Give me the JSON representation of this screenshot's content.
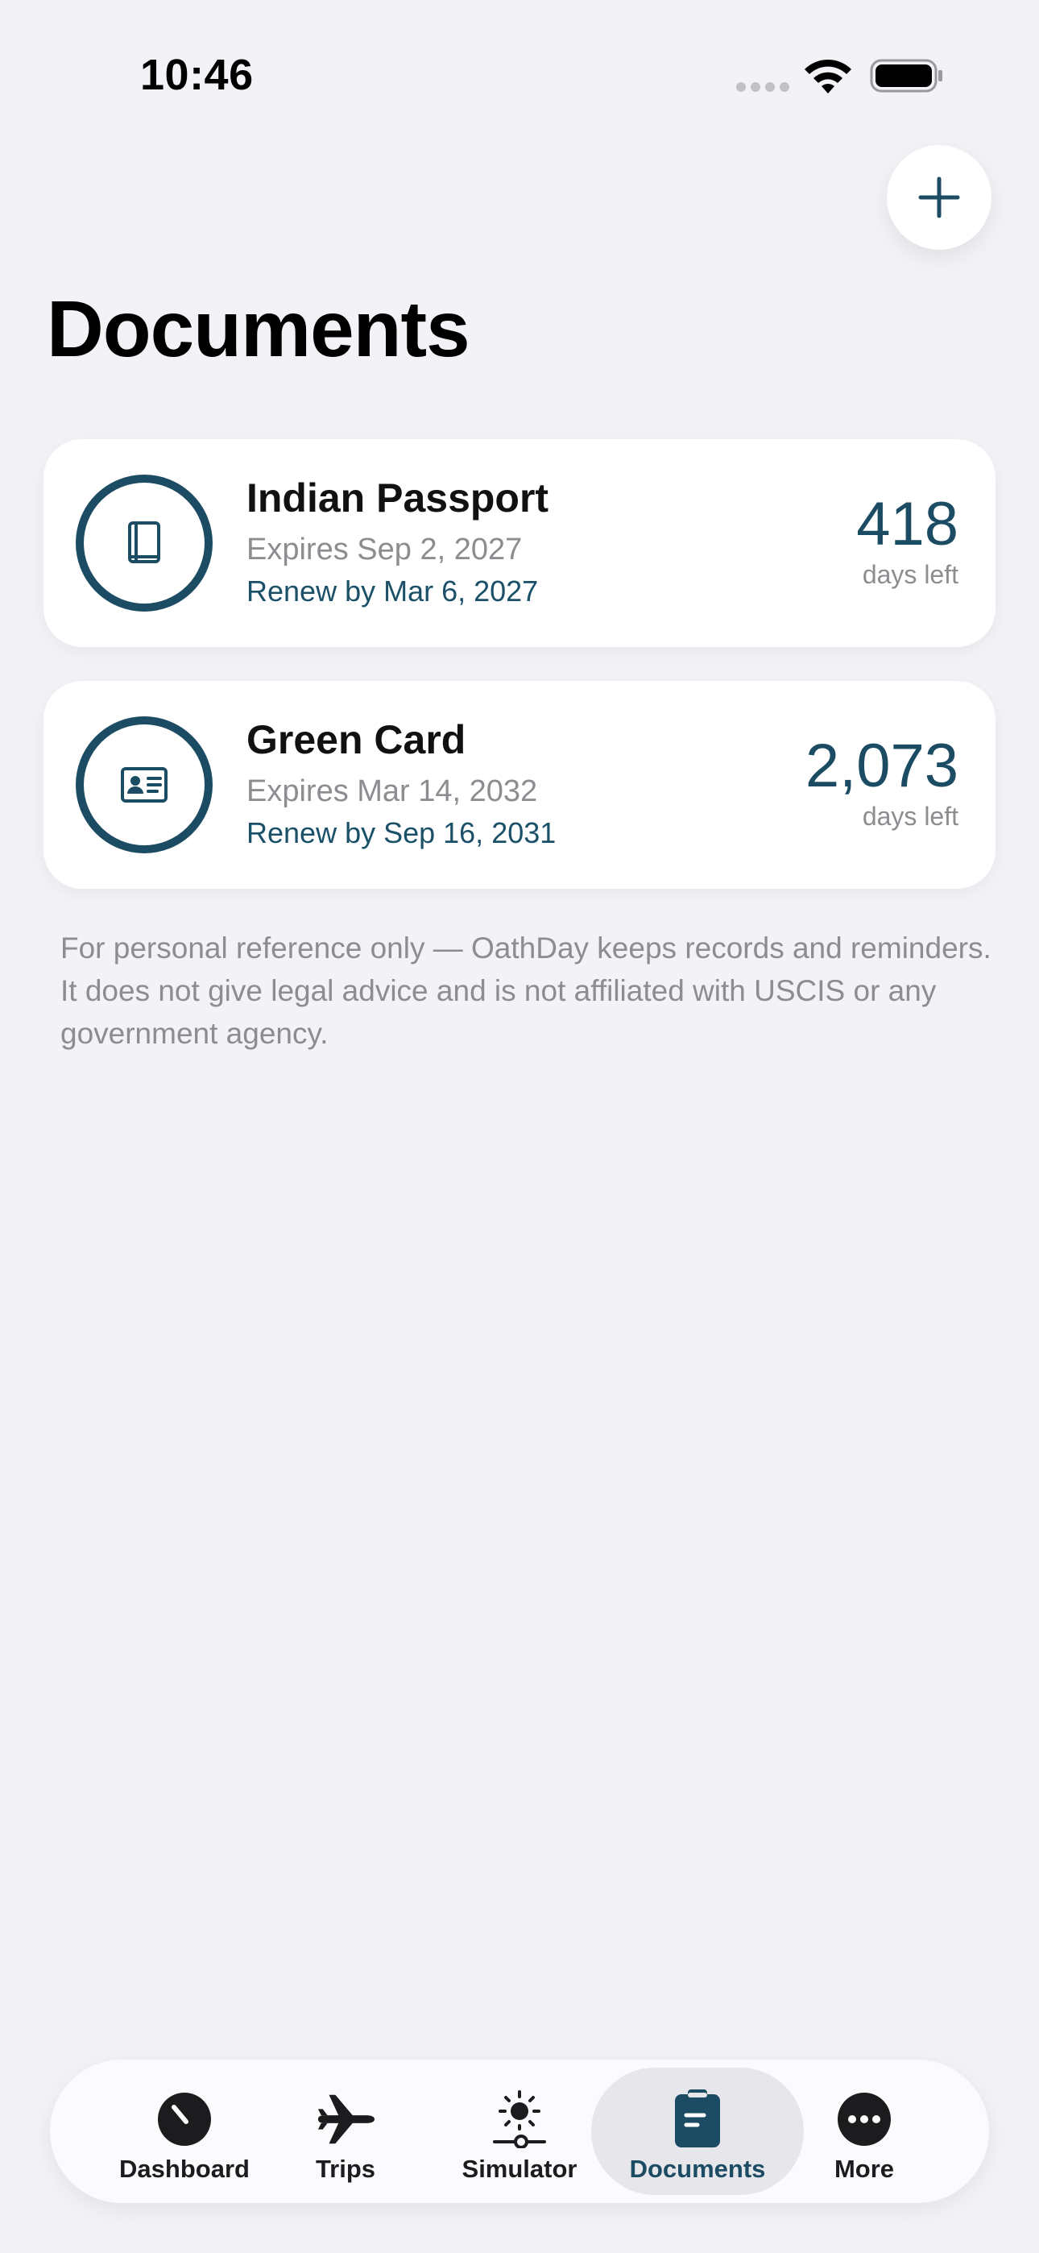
{
  "status_bar": {
    "time": "10:46"
  },
  "header": {
    "title": "Documents",
    "add_icon": "plus-icon"
  },
  "documents": [
    {
      "name": "Indian Passport",
      "icon": "passport-book-icon",
      "expires": "Expires Sep 2, 2027",
      "renew": "Renew by Mar 6, 2027",
      "days": "418",
      "days_label": "days left"
    },
    {
      "name": "Green Card",
      "icon": "id-card-icon",
      "expires": "Expires Mar 14, 2032",
      "renew": "Renew by Sep 16, 2031",
      "days": "2,073",
      "days_label": "days left"
    }
  ],
  "disclaimer": "For personal reference only — OathDay keeps records and reminders. It does not give legal advice and is not affiliated with USCIS or any government agency.",
  "tab_bar": {
    "selected": "Documents",
    "items": [
      {
        "label": "Dashboard",
        "icon": "gauge-icon"
      },
      {
        "label": "Trips",
        "icon": "airplane-icon"
      },
      {
        "label": "Simulator",
        "icon": "sun-slider-icon"
      },
      {
        "label": "Documents",
        "icon": "document-clipboard-icon"
      },
      {
        "label": "More",
        "icon": "ellipsis-circle-icon"
      }
    ]
  },
  "colors": {
    "accent": "#1b4c63",
    "background": "#f2f2f7",
    "secondary_text": "#8c8c91"
  }
}
